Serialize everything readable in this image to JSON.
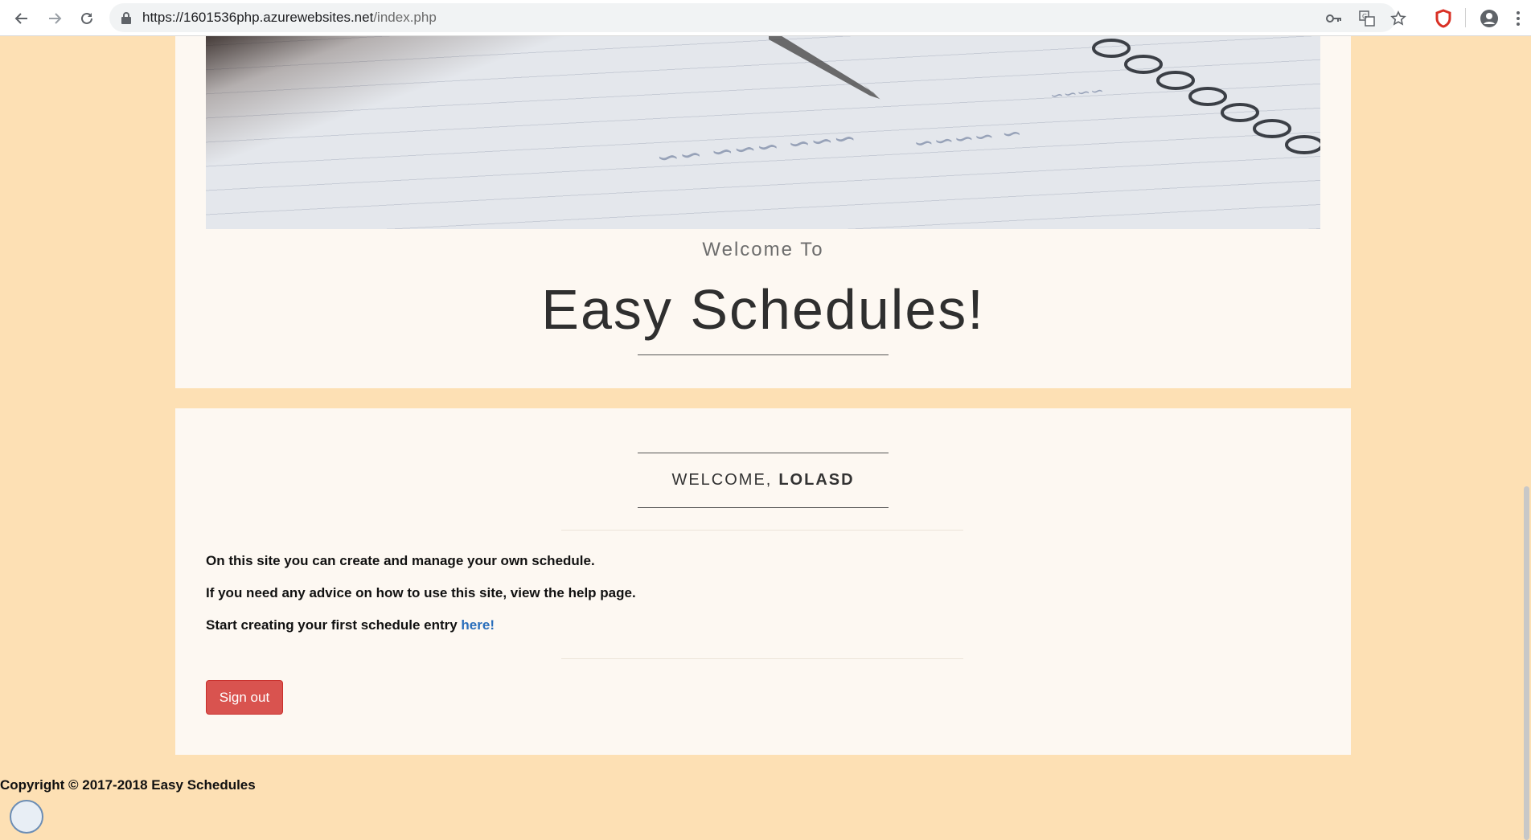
{
  "browser": {
    "url_host": "https://1601536php.azurewebsites.net",
    "url_path": "/index.php",
    "icons": [
      "back-icon",
      "forward-icon",
      "reload-icon",
      "lock-icon",
      "key-icon",
      "translate-icon",
      "star-icon",
      "shield-icon",
      "account-icon",
      "menu-icon"
    ]
  },
  "hero": {
    "welcome_to": "Welcome To",
    "title": "Easy Schedules!"
  },
  "main": {
    "welcome_prefix": "WELCOME,",
    "username": "LOLASD",
    "lines": [
      "On this site you can create and manage your own schedule.",
      "If you need any advice on how to use this site, view the help page.",
      "Start creating your first schedule entry "
    ],
    "link_text": "here!",
    "signout_label": "Sign out"
  },
  "footer": {
    "copyright": "Copyright © 2017-2018 Easy Schedules"
  },
  "colors": {
    "page_background": "#fde0b4",
    "card_background": "#fdf8f2",
    "signout_button": "#d9534f",
    "link": "#2a6ebb"
  }
}
